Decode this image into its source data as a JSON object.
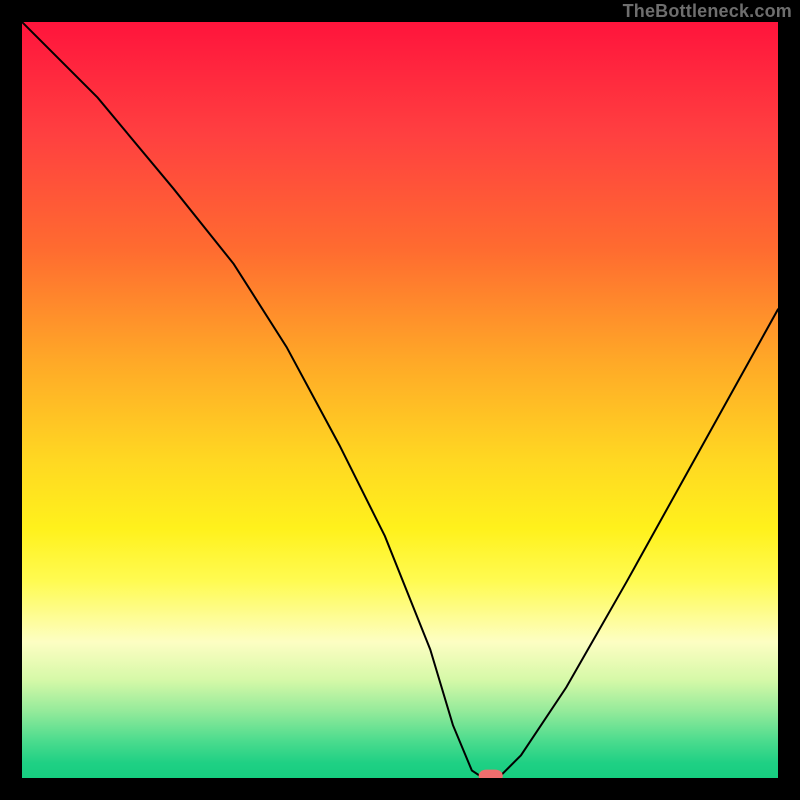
{
  "watermark": "TheBottleneck.com",
  "chart_data": {
    "type": "line",
    "title": "",
    "xlabel": "",
    "ylabel": "",
    "xlim": [
      0,
      100
    ],
    "ylim": [
      0,
      100
    ],
    "series": [
      {
        "name": "bottleneck-curve",
        "x": [
          0,
          10,
          20,
          28,
          35,
          42,
          48,
          54,
          57,
          59.5,
          61,
          63,
          64,
          66,
          72,
          80,
          90,
          100
        ],
        "values": [
          100,
          90,
          78,
          68,
          57,
          44,
          32,
          17,
          7,
          1,
          0,
          0,
          1,
          3,
          12,
          26,
          44,
          62
        ]
      }
    ],
    "marker": {
      "x": 62,
      "y": 0
    },
    "colors": {
      "curve": "#000000",
      "marker": "#ef6e6e",
      "top": "#ff143c",
      "bottom": "#16cd80",
      "frame": "#000000"
    }
  }
}
